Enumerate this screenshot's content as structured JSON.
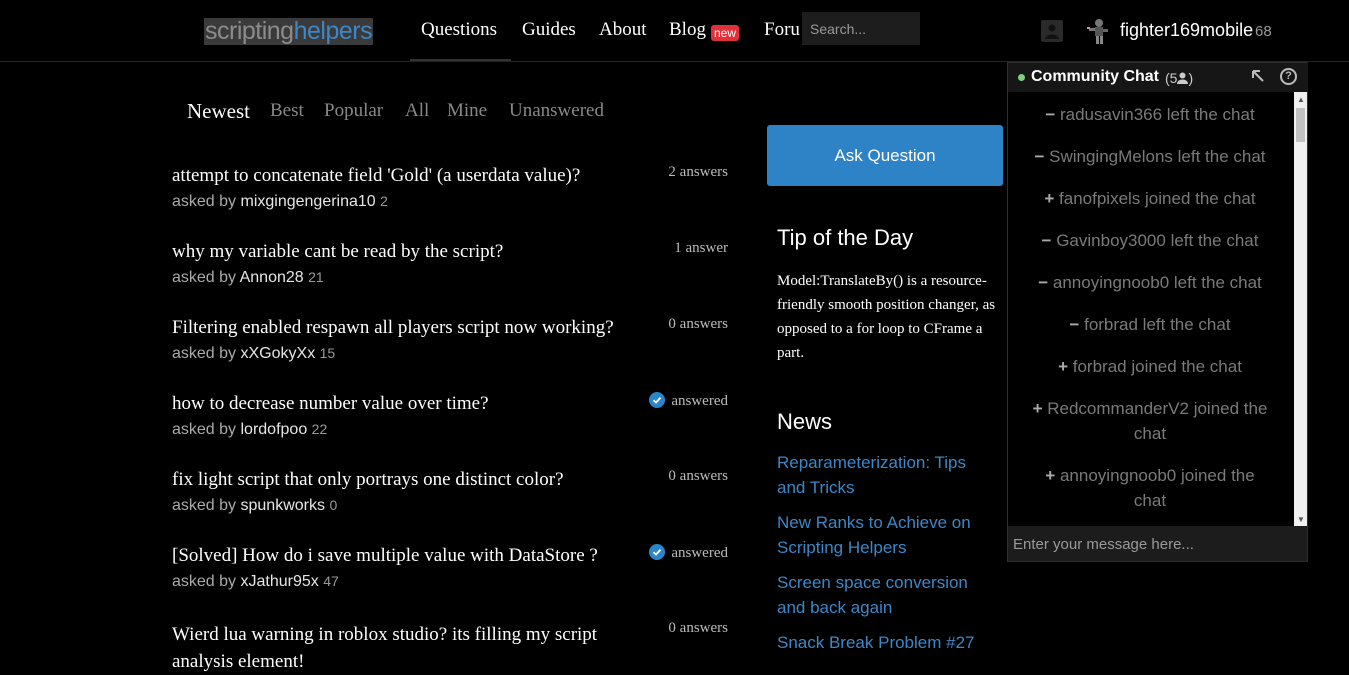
{
  "logo": {
    "part1": "scripting",
    "part2": "helpers"
  },
  "nav": {
    "items": [
      "Questions",
      "Guides",
      "About",
      "Blog",
      "Foru"
    ],
    "blog_badge": "new"
  },
  "search": {
    "placeholder": "Search..."
  },
  "user": {
    "name": "fighter169mobile",
    "rep": "68"
  },
  "tabs": [
    "Newest",
    "Best",
    "Popular",
    "All",
    "Mine",
    "Unanswered"
  ],
  "questions": [
    {
      "title": "attempt to concatenate field 'Gold' (a userdata value)?",
      "asked_prefix": "asked by",
      "user": "mixgingengerina10",
      "rep": "2",
      "status": "2 answers"
    },
    {
      "title": "why my variable cant be read by the script?",
      "asked_prefix": "asked by",
      "user": "Annon28",
      "rep": "21",
      "status": "1 answer"
    },
    {
      "title": "Filtering enabled respawn all players script now working?",
      "asked_prefix": "asked by",
      "user": "xXGokyXx",
      "rep": "15",
      "status": "0 answers"
    },
    {
      "title": "how to decrease number value over time?",
      "asked_prefix": "asked by",
      "user": "lordofpoo",
      "rep": "22",
      "status": "answered"
    },
    {
      "title": "fix light script that only portrays one distinct color?",
      "asked_prefix": "asked by",
      "user": "spunkworks",
      "rep": "0",
      "status": "0 answers"
    },
    {
      "title": "[Solved] How do i save multiple value with DataStore ?",
      "asked_prefix": "asked by",
      "user": "xJathur95x",
      "rep": "47",
      "status": "answered"
    },
    {
      "title": "Wierd lua warning in roblox studio? its filling my script analysis element!",
      "status": "0 answers"
    }
  ],
  "sidebar": {
    "ask_button": "Ask Question",
    "tip_heading": "Tip of the Day",
    "tip_text": "Model:TranslateBy() is a resource-friendly smooth position changer, as opposed to a for loop to CFrame a part.",
    "news_heading": "News",
    "news": [
      "Reparameterization: Tips and Tricks",
      "New Ranks to Achieve on Scripting Helpers",
      "Screen space conversion and back again",
      "Snack Break Problem #27"
    ]
  },
  "chat": {
    "title": "Community Chat",
    "count": "(5",
    "count_close": ")",
    "input_placeholder": "Enter your message here...",
    "messages": [
      {
        "sym": "−",
        "text": "radusavin366 left the chat"
      },
      {
        "sym": "−",
        "text": "SwingingMelons left the chat"
      },
      {
        "sym": "+",
        "text": "fanofpixels joined the chat"
      },
      {
        "sym": "−",
        "text": "Gavinboy3000 left the chat"
      },
      {
        "sym": "−",
        "text": "annoyingnoob0 left the chat"
      },
      {
        "sym": "−",
        "text": "forbrad left the chat"
      },
      {
        "sym": "+",
        "text": "forbrad joined the chat"
      },
      {
        "sym": "+",
        "text": "RedcommanderV2 joined the chat"
      },
      {
        "sym": "+",
        "text": "annoyingnoob0 joined the chat"
      }
    ]
  },
  "colors": {
    "accent": "#2d83c5",
    "link": "#3d87c7",
    "badge": "#e0303a",
    "online": "#7ed07e"
  }
}
